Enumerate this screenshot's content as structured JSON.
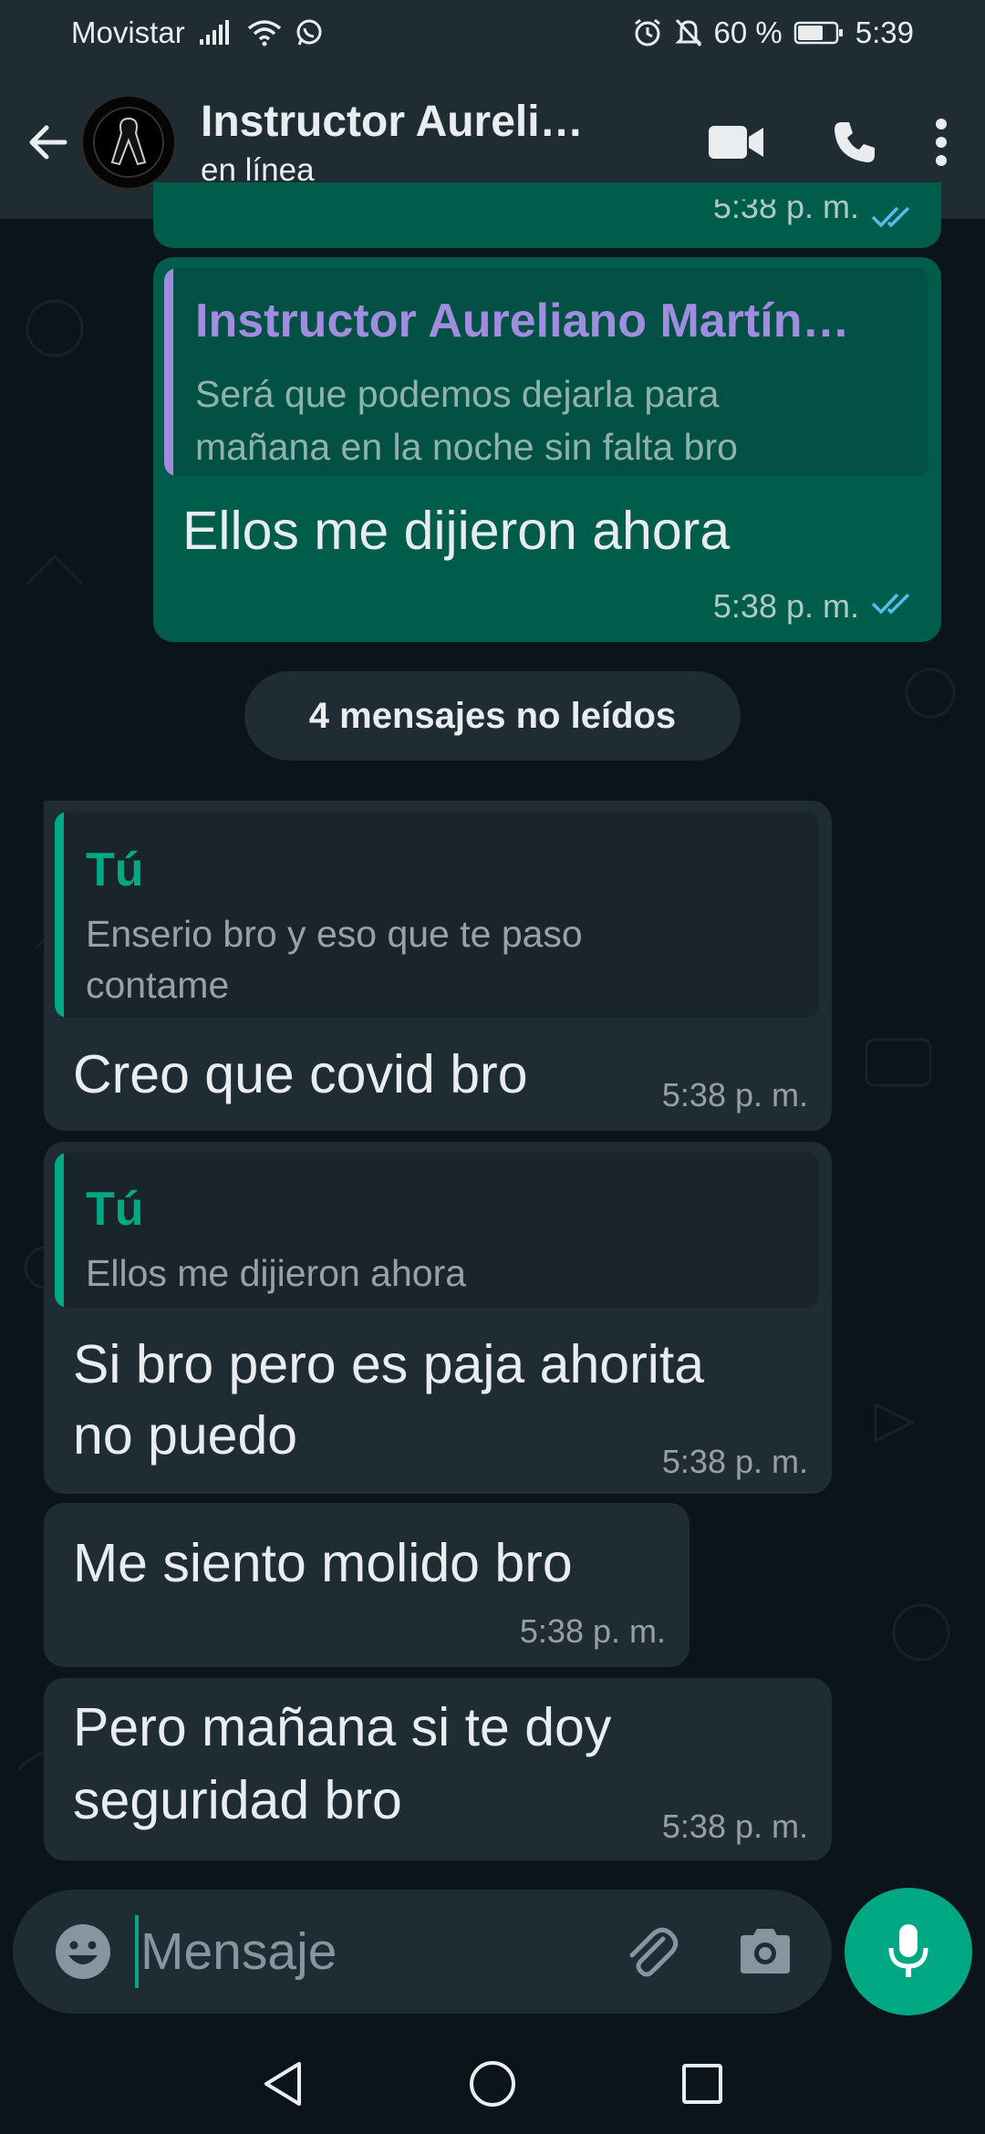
{
  "status_bar": {
    "carrier": "Movistar",
    "battery": "60 %",
    "time": "5:39"
  },
  "header": {
    "contact_name": "Instructor Aureli…",
    "contact_status": "en línea"
  },
  "messages": [
    {
      "direction": "outgoing",
      "partial": true,
      "time": "5:38 p. m.",
      "read": true
    },
    {
      "direction": "outgoing",
      "quote_author": "Instructor Aureliano Martín…",
      "quote_lines": [
        "Será que podemos dejarla para",
        "mañana en la noche sin falta bro"
      ],
      "text": "Ellos me dijieron ahora",
      "time": "5:38 p. m.",
      "read": true
    },
    {
      "direction": "incoming",
      "quote_author": "Tú",
      "quote_lines": [
        "Enserio bro y eso que te paso",
        "contame"
      ],
      "text": "Creo que covid bro",
      "time": "5:38 p. m."
    },
    {
      "direction": "incoming",
      "quote_author": "Tú",
      "quote_lines": [
        "Ellos me dijieron ahora"
      ],
      "text_lines": [
        "Si bro pero es paja ahorita",
        "no puedo"
      ],
      "time": "5:38 p. m."
    },
    {
      "direction": "incoming",
      "text": "Me siento molido bro",
      "time": "5:38 p. m."
    },
    {
      "direction": "incoming",
      "text_lines": [
        "Pero mañana si te doy",
        "seguridad bro"
      ],
      "time": "5:38 p. m."
    }
  ],
  "unread_divider": "4 mensajes no leídos",
  "composer": {
    "placeholder": "Mensaje"
  },
  "colors": {
    "header_bg": "#1f2c33",
    "chat_bg": "#0b141a",
    "outgoing_bubble": "#005c4b",
    "incoming_bubble": "#1f2c33",
    "accent_green": "#00a884",
    "quote_author_other": "#a08de0",
    "read_ticks": "#53bdeb"
  },
  "icons": {
    "back": "arrow-left-icon",
    "video": "video-camera-icon",
    "call": "phone-icon",
    "more": "more-vertical-icon",
    "emoji": "emoji-icon",
    "attach": "paperclip-icon",
    "camera": "camera-icon",
    "mic": "microphone-icon"
  }
}
